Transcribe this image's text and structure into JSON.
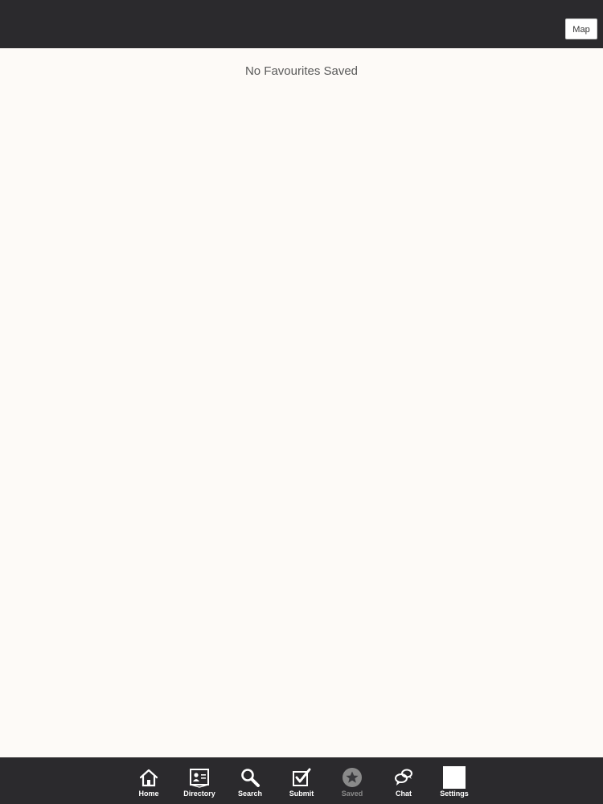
{
  "header": {
    "map_button": "Map"
  },
  "content": {
    "empty_message": "No Favourites Saved"
  },
  "tabs": [
    {
      "label": "Home",
      "icon": "home-icon"
    },
    {
      "label": "Directory",
      "icon": "directory-card-icon"
    },
    {
      "label": "Search",
      "icon": "search-icon"
    },
    {
      "label": "Submit",
      "icon": "checkbox-icon"
    },
    {
      "label": "Saved",
      "icon": "star-icon",
      "selected": true
    },
    {
      "label": "Chat",
      "icon": "chat-bubbles-icon"
    },
    {
      "label": "Settings",
      "icon": "settings-icon"
    }
  ],
  "colors": {
    "bar_background": "#2b2a2d",
    "page_background": "#fdfaf7",
    "tab_label": "#ffffff",
    "tab_label_selected": "#8a8a8a"
  }
}
